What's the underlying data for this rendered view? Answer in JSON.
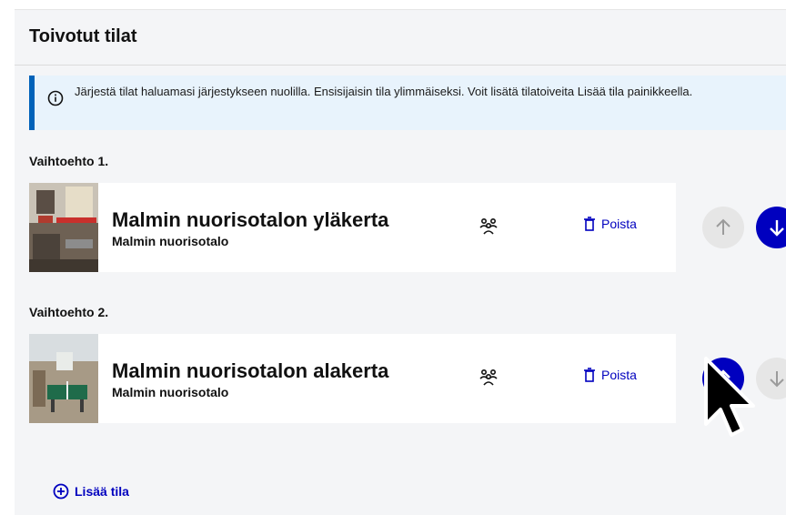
{
  "section": {
    "title": "Toivotut tilat"
  },
  "notice": {
    "text": "Järjestä tilat haluamasi järjestykseen nuolilla. Ensisijaisin tila ylimmäiseksi. Voit lisätä tilatoiveita Lisää tila painikkeella.",
    "icon": "info-icon"
  },
  "options": [
    {
      "label": "Vaihtoehto 1.",
      "title": "Malmin nuorisotalon yläkerta",
      "subtitle": "Malmin nuorisotalo",
      "delete_label": "Poista",
      "up_enabled": false,
      "down_enabled": true
    },
    {
      "label": "Vaihtoehto 2.",
      "title": "Malmin nuorisotalon alakerta",
      "subtitle": "Malmin nuorisotalo",
      "delete_label": "Poista",
      "up_enabled": true,
      "down_enabled": false
    }
  ],
  "add_button": {
    "label": "Lisää tila"
  },
  "colors": {
    "accent": "#0000bf",
    "notice_bg": "#e8f3fc",
    "notice_border": "#0062b9",
    "disabled": "#e6e6e6",
    "panel_bg": "#f4f5f7"
  }
}
